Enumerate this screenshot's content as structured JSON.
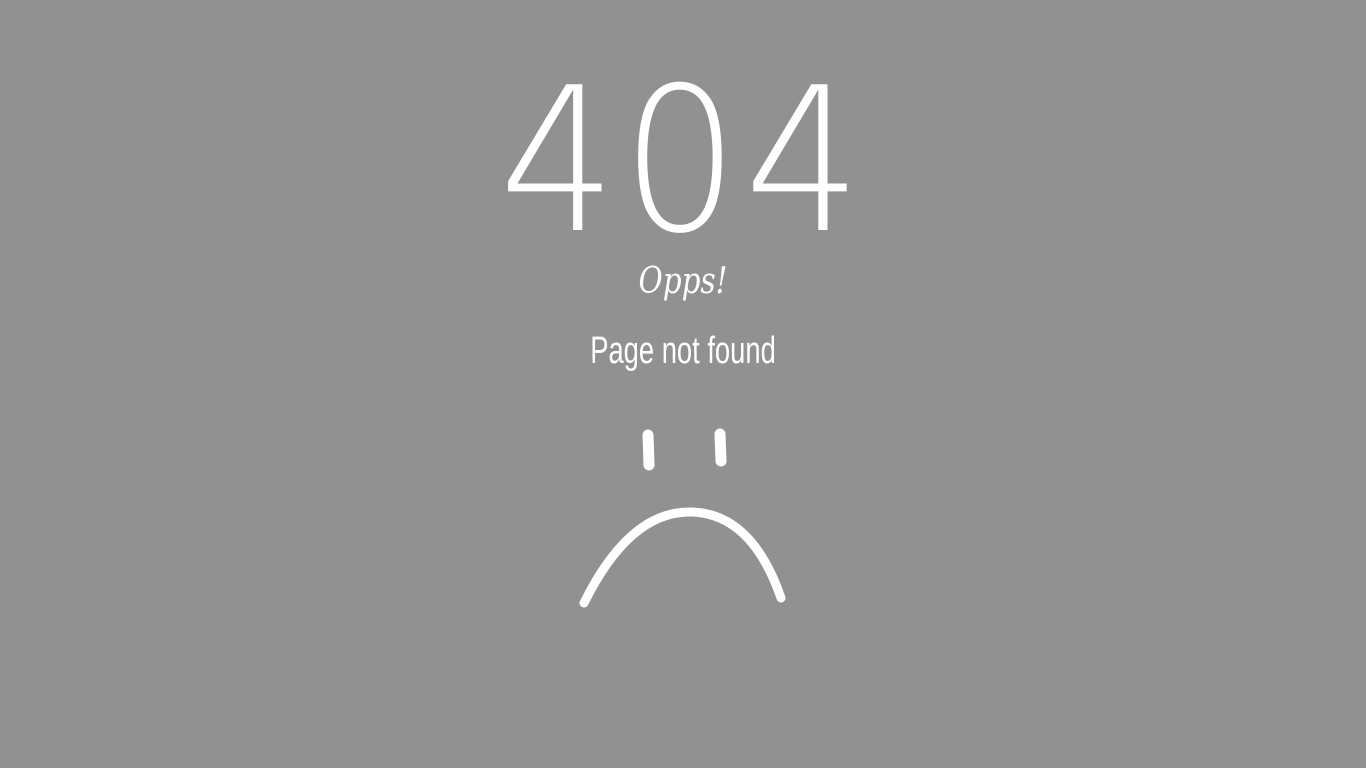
{
  "error": {
    "code": "404",
    "exclamation": "Opps!",
    "message": "Page not found"
  },
  "icons": {
    "sad_face": "sad-face-icon"
  },
  "colors": {
    "background": "#919191",
    "foreground": "#ffffff"
  }
}
